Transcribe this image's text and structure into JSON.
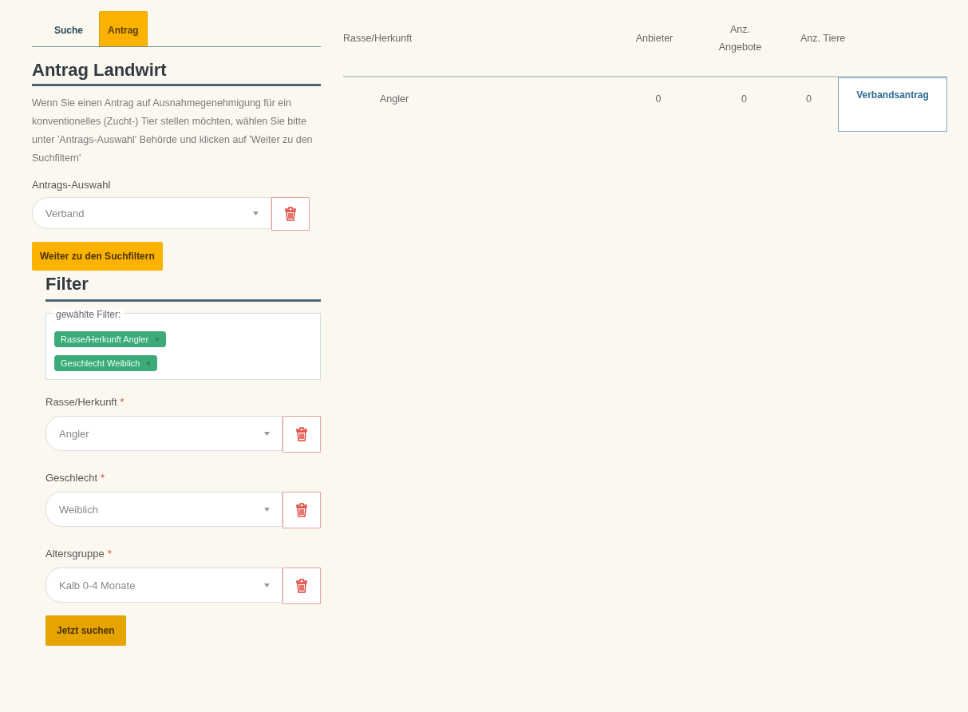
{
  "tabs": [
    {
      "label": "Suche",
      "selected": false
    },
    {
      "label": "Antrag",
      "selected": true
    }
  ],
  "heading": "Antrag Landwirt",
  "intro": "Wenn Sie einen Antrag auf Ausnahmegenehmigung für ein konventionelles (Zucht-) Tier stellen möchten, wählen Sie bitte unter 'Antrags-Auswahl' Behörde und klicken auf 'Weiter zu den Suchfiltern'",
  "application_select": {
    "label": "Antrags-Auswahl",
    "value": "Verband"
  },
  "continue_button": "Weiter zu den Suchfiltern",
  "filter": {
    "heading": "Filter",
    "chosen_legend": "gewählte Filter:",
    "chips": [
      {
        "label": "Rasse/Herkunft Angler",
        "color": "#3daa7a"
      },
      {
        "label": "Geschlecht Weiblich",
        "color": "#3daa7a"
      }
    ],
    "fields": [
      {
        "label": "Rasse/Herkunft",
        "required": true,
        "mark": "*",
        "value": "Angler"
      },
      {
        "label": "Geschlecht",
        "required": true,
        "mark": "*",
        "value": "Weiblich"
      },
      {
        "label": "Altersgruppe",
        "required": true,
        "mark": "*",
        "value": "Kalb 0-4 Monate"
      }
    ],
    "search_button": "Jetzt suchen"
  },
  "table": {
    "columns": [
      "Rasse/Herkunft",
      "Anbieter",
      "Anz. Angebote",
      "Anz. Tiere"
    ],
    "rows": [
      {
        "breed": "Angler",
        "providers": "0",
        "offers": "0",
        "animals": "0",
        "action": "Verbandsantrag"
      }
    ]
  }
}
